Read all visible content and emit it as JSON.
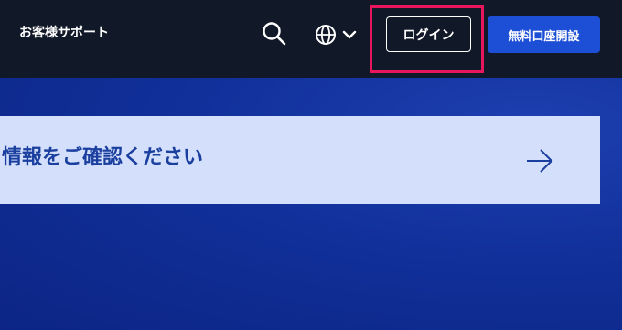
{
  "header": {
    "support_label": "お客様サポート",
    "search_icon": "search-icon",
    "language_icon": "globe-icon",
    "language_chevron": "chevron-down-icon",
    "login_label": "ログイン",
    "open_account_label": "無料口座開設"
  },
  "banner": {
    "text": "情報をご確認ください",
    "arrow_icon": "arrow-right-icon"
  },
  "colors": {
    "header_bg": "#111827",
    "hero_bg": "#0f2a8c",
    "banner_bg": "#d3dffb",
    "banner_text": "#1a3f9e",
    "primary_button": "#1d4fd6",
    "highlight": "#e8175d"
  }
}
